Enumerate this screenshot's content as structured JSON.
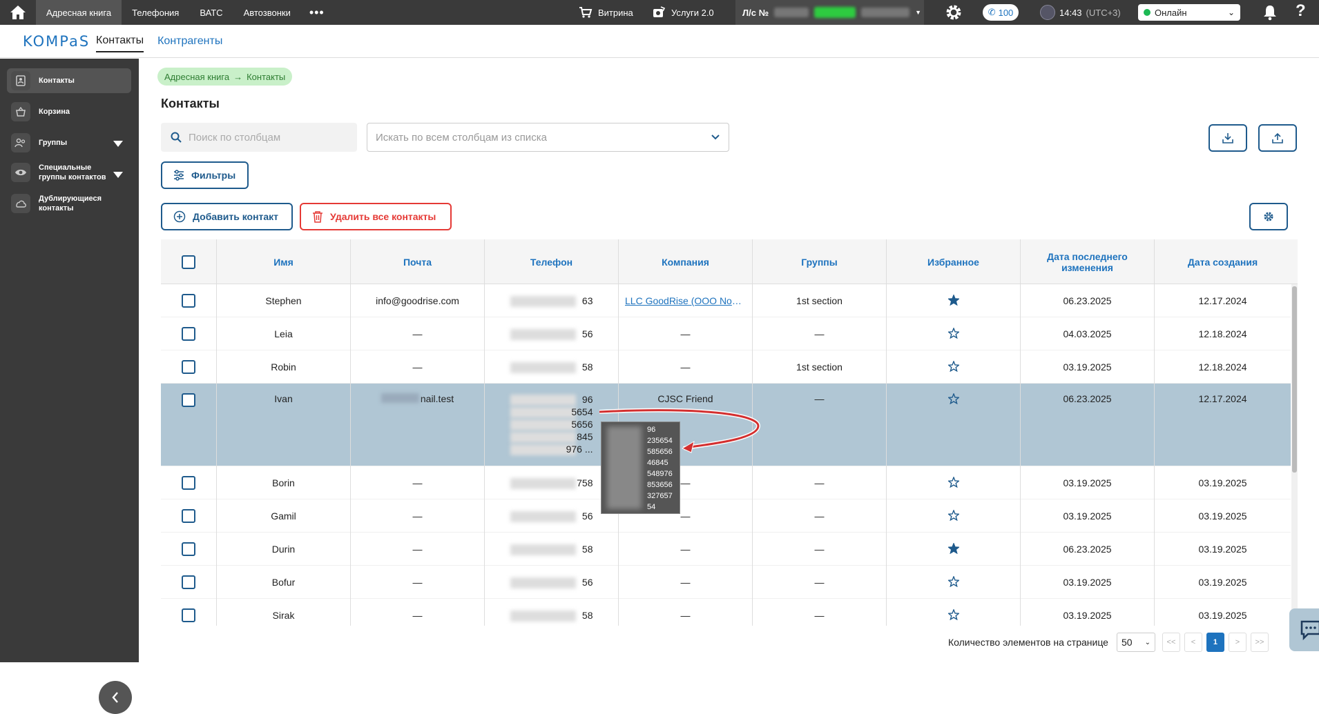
{
  "topbar": {
    "nav": [
      "Адресная книга",
      "Телефония",
      "ВАТС",
      "Автозвонки"
    ],
    "more": "•••",
    "vitrina": "Витрина",
    "uslugi": "Услуги 2.0",
    "account_label": "Л/с №",
    "calls_count": "100",
    "time": "14:43",
    "tz": "(UTC+3)",
    "status": "Онлайн",
    "help": "?"
  },
  "subheader": {
    "logo": "KOMPaS",
    "tabs": [
      "Контакты",
      "Контрагенты"
    ]
  },
  "sidebar": {
    "items": [
      {
        "label": "Контакты",
        "icon": "contacts-book-icon"
      },
      {
        "label": "Корзина",
        "icon": "basket-icon"
      },
      {
        "label": "Группы",
        "icon": "group-icon"
      },
      {
        "label": "Специальные группы контактов",
        "icon": "eye-icon"
      },
      {
        "label": "Дублирующиеся контакты",
        "icon": "cloud-icon"
      }
    ]
  },
  "breadcrumb": {
    "root": "Адресная книга",
    "arrow": "→",
    "current": "Контакты"
  },
  "page_title": "Контакты",
  "search": {
    "placeholder": "Поиск по столбцам"
  },
  "column_select": {
    "placeholder": "Искать по всем столбцам из списка"
  },
  "buttons": {
    "filters": "Фильтры",
    "add": "Добавить контакт",
    "delete_all": "Удалить все контакты"
  },
  "table": {
    "headers": [
      "Имя",
      "Почта",
      "Телефон",
      "Компания",
      "Группы",
      "Избранное",
      "Дата последнего изменения",
      "Дата создания"
    ],
    "rows": [
      {
        "name": "Stephen",
        "email": "info@goodrise.com",
        "phone": "63",
        "company": "LLC GoodRise (ООО Nos…",
        "group": "1st section",
        "fav": true,
        "modified": "06.23.2025",
        "created": "12.17.2024"
      },
      {
        "name": "Leia",
        "email": "—",
        "phone": "56",
        "company": "—",
        "group": "—",
        "fav": false,
        "modified": "04.03.2025",
        "created": "12.18.2024"
      },
      {
        "name": "Robin",
        "email": "—",
        "phone": "58",
        "company": "—",
        "group": "1st section",
        "fav": false,
        "modified": "03.19.2025",
        "created": "12.18.2024"
      },
      {
        "name": "Ivan",
        "email": "nail.test",
        "phone_lines": [
          "96",
          "5654",
          "5656",
          "845",
          "976 ..."
        ],
        "company": "CJSC Friend",
        "group": "—",
        "fav": false,
        "modified": "06.23.2025",
        "created": "12.17.2024"
      },
      {
        "name": "Borin",
        "email": "—",
        "phone": "758",
        "company": "—",
        "group": "—",
        "fav": false,
        "modified": "03.19.2025",
        "created": "03.19.2025"
      },
      {
        "name": "Gamil",
        "email": "—",
        "phone": "56",
        "company": "—",
        "group": "—",
        "fav": false,
        "modified": "03.19.2025",
        "created": "03.19.2025"
      },
      {
        "name": "Durin",
        "email": "—",
        "phone": "58",
        "company": "—",
        "group": "—",
        "fav": true,
        "modified": "06.23.2025",
        "created": "03.19.2025"
      },
      {
        "name": "Bofur",
        "email": "—",
        "phone": "56",
        "company": "—",
        "group": "—",
        "fav": false,
        "modified": "03.19.2025",
        "created": "03.19.2025"
      },
      {
        "name": "Sirak",
        "email": "—",
        "phone": "58",
        "company": "—",
        "group": "—",
        "fav": false,
        "modified": "03.19.2025",
        "created": "03.19.2025"
      }
    ]
  },
  "tooltip_phones": [
    "96",
    "235654",
    "585656",
    "46845",
    "548976",
    "853656",
    "327657",
    "54"
  ],
  "pager": {
    "label": "Количество элементов на странице",
    "size": "50",
    "first": "<<",
    "prev": "<",
    "page": "1",
    "next": ">",
    "last": ">>"
  },
  "colors": {
    "accent": "#1e73be",
    "dark": "#3a3a3a",
    "danger": "#e53935",
    "online": "#1db954",
    "selected_row": "#b0c6d4"
  }
}
